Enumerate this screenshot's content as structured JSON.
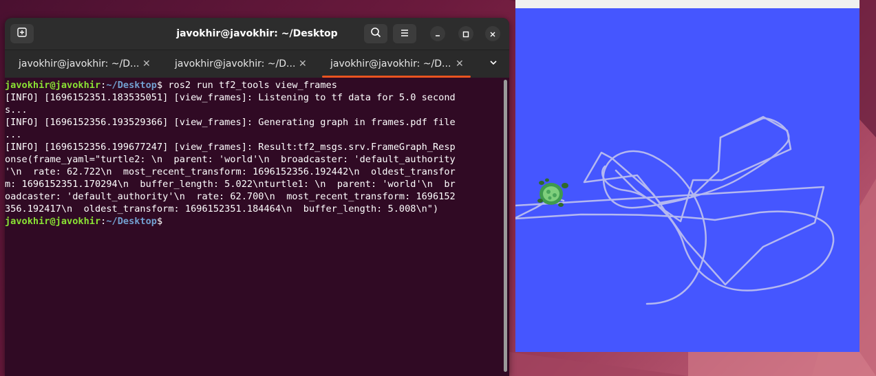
{
  "window": {
    "title": "javokhir@javokhir: ~/Desktop"
  },
  "tabs": [
    {
      "label": "javokhir@javokhir: ~/D...",
      "active": false
    },
    {
      "label": "javokhir@javokhir: ~/D...",
      "active": false
    },
    {
      "label": "javokhir@javokhir: ~/D...",
      "active": true
    }
  ],
  "icons": {
    "new_tab": "new-tab-icon",
    "search": "search-icon",
    "menu": "hamburger-menu-icon",
    "minimize": "minimize-icon",
    "maximize": "maximize-icon",
    "close": "close-icon",
    "tab_close": "close-icon",
    "tabs_dropdown": "chevron-down-icon"
  },
  "terminal": {
    "prompt_user": "javokhir@javokhir",
    "prompt_sep": ":",
    "prompt_path": "~/Desktop",
    "prompt_symbol": "$",
    "command": " ros2 run tf2_tools view_frames",
    "output_lines": [
      "[INFO] [1696152351.183535051] [view_frames]: Listening to tf data for 5.0 second",
      "s...",
      "[INFO] [1696152356.193529366] [view_frames]: Generating graph in frames.pdf file",
      "...",
      "[INFO] [1696152356.199677247] [view_frames]: Result:tf2_msgs.srv.FrameGraph_Resp",
      "onse(frame_yaml=\"turtle2: \\n  parent: 'world'\\n  broadcaster: 'default_authority",
      "'\\n  rate: 62.722\\n  most_recent_transform: 1696152356.192442\\n  oldest_transfor",
      "m: 1696152351.170294\\n  buffer_length: 5.022\\nturtle1: \\n  parent: 'world'\\n  br",
      "oadcaster: 'default_authority'\\n  rate: 62.700\\n  most_recent_transform: 1696152",
      "356.192417\\n  oldest_transform: 1696152351.184464\\n  buffer_length: 5.008\\n\")"
    ]
  },
  "colors": {
    "terminal_bg": "#300a24",
    "prompt_user": "#8ae234",
    "prompt_path": "#729fcf",
    "tab_accent": "#e95420",
    "turtlesim_bg": "#4556ff",
    "trail": "#b4b8f0"
  },
  "turtlesim": {
    "turtle_icon": "turtle-icon"
  }
}
